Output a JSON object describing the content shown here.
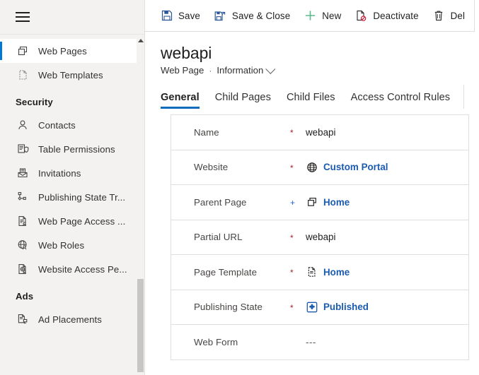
{
  "sidebar": {
    "menu_icon": "hamburger-icon",
    "items": [
      {
        "label": "Web Pages",
        "icon": "web-pages-icon",
        "selected": true
      },
      {
        "label": "Web Templates",
        "icon": "web-templates-icon",
        "selected": false
      }
    ],
    "groups": [
      {
        "title": "Security",
        "items": [
          {
            "label": "Contacts",
            "icon": "contact-person-icon"
          },
          {
            "label": "Table  Permissions",
            "icon": "table-permissions-icon"
          },
          {
            "label": "Invitations",
            "icon": "invitations-envelope-icon"
          },
          {
            "label": "Publishing State Tr...",
            "icon": "publishing-state-transition-icon"
          },
          {
            "label": "Web Page Access ...",
            "icon": "web-page-access-icon"
          },
          {
            "label": "Web Roles",
            "icon": "web-roles-globe-icon"
          },
          {
            "label": "Website Access Pe...",
            "icon": "website-access-permission-icon"
          }
        ]
      },
      {
        "title": "Ads",
        "items": [
          {
            "label": "Ad Placements",
            "icon": "ad-placements-icon"
          }
        ]
      }
    ]
  },
  "commandbar": {
    "buttons": [
      {
        "label": "Save",
        "icon": "save-icon"
      },
      {
        "label": "Save & Close",
        "icon": "save-and-close-icon"
      },
      {
        "label": "New",
        "icon": "plus-icon"
      },
      {
        "label": "Deactivate",
        "icon": "deactivate-icon"
      },
      {
        "label": "Del",
        "icon": "delete-trash-icon"
      }
    ]
  },
  "header": {
    "title": "webapi",
    "entity": "Web Page",
    "separator": "·",
    "form_name": "Information"
  },
  "tabs": [
    {
      "label": "General",
      "active": true
    },
    {
      "label": "Child Pages",
      "active": false
    },
    {
      "label": "Child Files",
      "active": false
    },
    {
      "label": "Access Control Rules",
      "active": false
    }
  ],
  "form": {
    "rows": [
      {
        "label": "Name",
        "required": "*",
        "required_kind": "required",
        "value": "webapi",
        "kind": "text",
        "icon": ""
      },
      {
        "label": "Website",
        "required": "*",
        "required_kind": "required",
        "value": "Custom Portal",
        "kind": "link",
        "icon": "globe-icon"
      },
      {
        "label": "Parent Page",
        "required": "+",
        "required_kind": "recommended",
        "value": "Home",
        "kind": "link",
        "icon": "web-pages-icon"
      },
      {
        "label": "Partial URL",
        "required": "*",
        "required_kind": "required",
        "value": "webapi",
        "kind": "text",
        "icon": ""
      },
      {
        "label": "Page Template",
        "required": "*",
        "required_kind": "required",
        "value": "Home",
        "kind": "link",
        "icon": "page-template-icon"
      },
      {
        "label": "Publishing State",
        "required": "*",
        "required_kind": "required",
        "value": "Published",
        "kind": "link",
        "icon": "publishing-state-icon"
      },
      {
        "label": "Web Form",
        "required": "",
        "required_kind": "none",
        "value": "---",
        "kind": "muted",
        "icon": ""
      }
    ]
  },
  "colors": {
    "accent": "#0078d4",
    "tab_underline": "#0f6cbd",
    "link": "#1b5bb0",
    "required": "#a4262c",
    "recommended": "#2266cc",
    "sidebar_bg": "#f3f2f1",
    "border": "#e1dfdd"
  }
}
